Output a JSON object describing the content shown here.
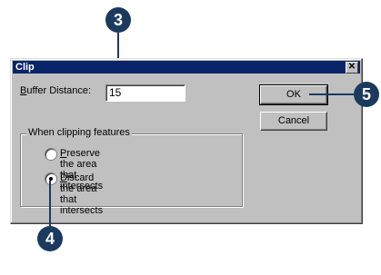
{
  "callouts": {
    "c3": "3",
    "c4": "4",
    "c5": "5"
  },
  "dialog": {
    "title": "Clip",
    "close_glyph": "✕",
    "buffer_label_first": "B",
    "buffer_label_rest": "uffer Distance:",
    "buffer_value": "15",
    "ok_label": "OK",
    "cancel_label": "Cancel",
    "group_label": "When clipping features",
    "options": [
      {
        "accel": "P",
        "rest": "reserve the area that intersects",
        "selected": false
      },
      {
        "accel": "D",
        "rest": "iscard the area that intersects",
        "selected": true
      }
    ]
  },
  "colors": {
    "callout": "#1c3a5e",
    "titlebar": "#0a246a",
    "face": "#c0c0c0"
  }
}
